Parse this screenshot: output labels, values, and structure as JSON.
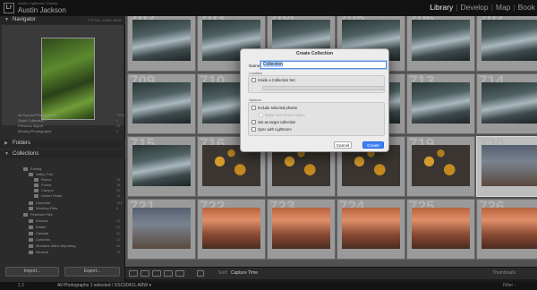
{
  "identity": {
    "line1": "Adobe Lightroom Classic",
    "line2": "Austin Jackson"
  },
  "modules": [
    {
      "label": "Library",
      "active": true
    },
    {
      "label": "Develop",
      "active": false
    },
    {
      "label": "Map",
      "active": false
    },
    {
      "label": "Book",
      "active": false
    }
  ],
  "navigator": {
    "title": "Navigator",
    "options": "FIT  FILL  100%  400%"
  },
  "catalog": {
    "items": [
      {
        "label": "All Synced Photographs",
        "count": "7533"
      },
      {
        "label": "Quick Collection +",
        "count": "0"
      },
      {
        "label": "Previous Import",
        "count": "24"
      },
      {
        "label": "Missing Photographs",
        "count": "3"
      }
    ]
  },
  "panels": {
    "folders": "Folders",
    "collections": "Collections"
  },
  "collections": {
    "items": [
      {
        "label": "Editing",
        "count": ""
      },
      {
        "label": "Valley Tour",
        "count": ""
      },
      {
        "label": "Rivers",
        "count": "34"
      },
      {
        "label": "Forest",
        "count": "18"
      },
      {
        "label": "Canyon",
        "count": "25"
      },
      {
        "label": "Desert Study",
        "count": "12"
      },
      {
        "label": "Unsorted",
        "count": "148"
      },
      {
        "label": "Working Files",
        "count": "9"
      },
      {
        "label": "Finished Files",
        "count": ""
      },
      {
        "label": "Arizona",
        "count": "41"
      },
      {
        "label": "Britain",
        "count": "22"
      },
      {
        "label": "Canada",
        "count": "30"
      },
      {
        "label": "Colorado",
        "count": "17"
      },
      {
        "label": "Montana Idaho Wyoming",
        "count": "26"
      },
      {
        "label": "Nevada",
        "count": "14"
      }
    ]
  },
  "left_buttons": {
    "import": "Import...",
    "export": "Export..."
  },
  "grid": {
    "cells": [
      {
        "num": "702",
        "kind": "river"
      },
      {
        "num": "703",
        "kind": "river"
      },
      {
        "num": "704",
        "kind": "river"
      },
      {
        "num": "705",
        "kind": "river"
      },
      {
        "num": "706",
        "kind": "river"
      },
      {
        "num": "707",
        "kind": "river"
      },
      {
        "num": "709",
        "kind": "river"
      },
      {
        "num": "710",
        "kind": "river"
      },
      {
        "num": "711",
        "kind": "river"
      },
      {
        "num": "712",
        "kind": "river"
      },
      {
        "num": "713",
        "kind": "river"
      },
      {
        "num": "714",
        "kind": "river"
      },
      {
        "num": "715",
        "kind": "river"
      },
      {
        "num": "716",
        "kind": "leaves"
      },
      {
        "num": "717",
        "kind": "leaves"
      },
      {
        "num": "718",
        "kind": "leaves"
      },
      {
        "num": "719",
        "kind": "leaves"
      },
      {
        "num": "720",
        "kind": "tree"
      },
      {
        "num": "721",
        "kind": "tree"
      },
      {
        "num": "722",
        "kind": "canyon"
      },
      {
        "num": "723",
        "kind": "canyon"
      },
      {
        "num": "724",
        "kind": "canyon"
      },
      {
        "num": "725",
        "kind": "canyon"
      },
      {
        "num": "726",
        "kind": "canyon"
      }
    ]
  },
  "toolbar": {
    "sort_label": "Sort:",
    "sort_value": "Capture Time",
    "thumbs_label": "Thumbnails"
  },
  "status": {
    "pages": "1  2",
    "path": "All Photographs   1 selected / DSC00431.ARW  ▾",
    "filter": "Filter :"
  },
  "dialog": {
    "title": "Create Collection",
    "name_label": "Name:",
    "name_value": "Collection",
    "location_label": "Location",
    "inside_set": "Inside a Collection Set",
    "options_label": "Options",
    "include_selected": "Include selected photos",
    "make_virtual": "Make new virtual copies",
    "set_target": "Set as target collection",
    "sync_lightroom": "Sync with Lightroom",
    "cancel": "Cancel",
    "create": "Create"
  },
  "colors": {
    "accent": "#3b82f6",
    "panel": "#2b2b2b",
    "grid": "#525252"
  }
}
